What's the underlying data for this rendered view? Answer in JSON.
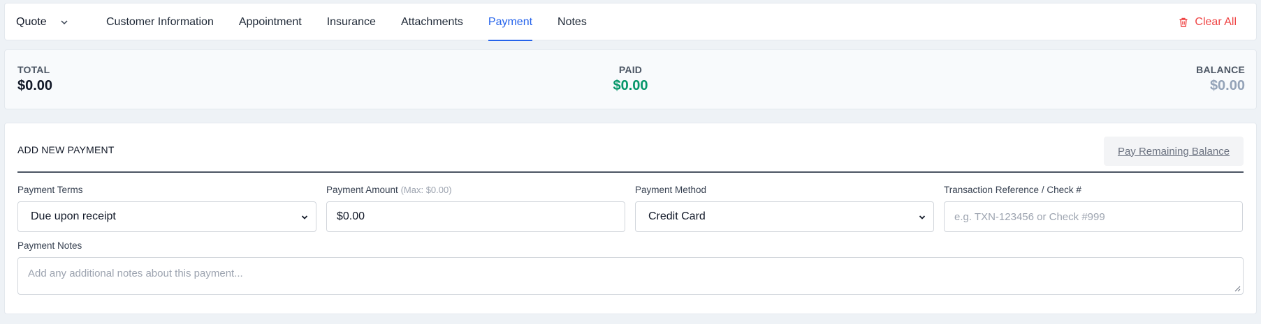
{
  "header": {
    "doc_type": "Quote",
    "tabs": [
      {
        "label": "Customer Information"
      },
      {
        "label": "Appointment"
      },
      {
        "label": "Insurance"
      },
      {
        "label": "Attachments"
      },
      {
        "label": "Payment",
        "active": true
      },
      {
        "label": "Notes"
      }
    ],
    "clear_all": "Clear All"
  },
  "summary": {
    "total_label": "TOTAL",
    "total_value": "$0.00",
    "paid_label": "PAID",
    "paid_value": "$0.00",
    "balance_label": "BALANCE",
    "balance_value": "$0.00"
  },
  "form": {
    "title": "ADD NEW PAYMENT",
    "pay_remaining": "Pay Remaining Balance",
    "payment_terms_label": "Payment Terms",
    "payment_terms_value": "Due upon receipt",
    "payment_amount_label": "Payment Amount",
    "payment_amount_hint": "(Max: $0.00)",
    "payment_amount_value": "$0.00",
    "payment_method_label": "Payment Method",
    "payment_method_value": "Credit Card",
    "txn_ref_label": "Transaction Reference / Check #",
    "txn_ref_placeholder": "e.g. TXN-123456 or Check #999",
    "notes_label": "Payment Notes",
    "notes_placeholder": "Add any additional notes about this payment..."
  },
  "colors": {
    "accent": "#2563eb",
    "danger": "#ef4444",
    "paid": "#059669",
    "balance": "#94a3b8"
  },
  "icons": [
    "chevron-down-icon",
    "trash-icon",
    "resize-handle-icon"
  ]
}
